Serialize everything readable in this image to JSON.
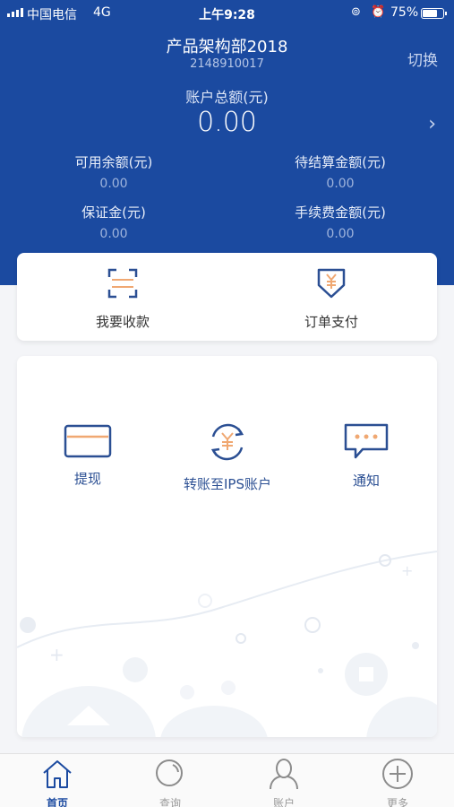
{
  "status_bar": {
    "carrier": "中国电信",
    "network": "4G",
    "time": "上午9:28",
    "battery": "75%"
  },
  "header": {
    "company_name": "产品架构部2018",
    "company_id": "2148910017",
    "switch_label": "切换",
    "total_label": "账户总额(元)",
    "total_value": "0.00"
  },
  "stats": [
    {
      "label": "可用余额(元)",
      "value": "0.00"
    },
    {
      "label": "待结算金额(元)",
      "value": "0.00"
    },
    {
      "label": "保证金(元)",
      "value": "0.00"
    },
    {
      "label": "手续费金额(元)",
      "value": "0.00"
    }
  ],
  "quick_actions": [
    {
      "label": "我要收款",
      "icon": "scan-icon"
    },
    {
      "label": "订单支付",
      "icon": "yen-download-icon"
    }
  ],
  "services": [
    {
      "label": "提现",
      "icon": "card-icon"
    },
    {
      "label": "转账至IPS账户",
      "icon": "yen-transfer-icon"
    },
    {
      "label": "通知",
      "icon": "message-icon"
    }
  ],
  "tabs": [
    {
      "label": "首页",
      "icon": "home-icon",
      "active": true
    },
    {
      "label": "查询",
      "icon": "search-icon",
      "active": false
    },
    {
      "label": "账户",
      "icon": "user-icon",
      "active": false
    },
    {
      "label": "更多",
      "icon": "plus-circle-icon",
      "active": false
    }
  ],
  "colors": {
    "brand": "#1b4aa0",
    "accent": "#f0a872",
    "text_dark": "#333333"
  }
}
